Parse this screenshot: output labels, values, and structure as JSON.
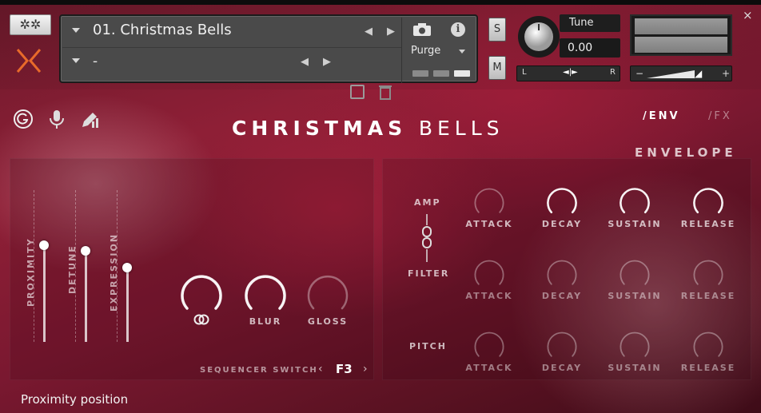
{
  "header": {
    "gear_label": "✲✲",
    "preset": {
      "name": "01. Christmas Bells",
      "sub": "-",
      "purge_label": "Purge"
    },
    "solo_label": "S",
    "mute_label": "M",
    "tune": {
      "label": "Tune",
      "value": "0.00"
    },
    "pan": {
      "left": "L",
      "right": "R"
    },
    "volume": {
      "minus": "−",
      "plus": "+"
    },
    "close_label": "×"
  },
  "instrument": {
    "title_bold": "CHRISTMAS",
    "title_light": "BELLS",
    "tabs": {
      "env": "/ENV",
      "fx": "/FX"
    },
    "envelope_heading": "ENVELOPE",
    "sliders": [
      {
        "label": "PROXIMITY",
        "value": 0.67
      },
      {
        "label": "DETUNE",
        "value": 0.63
      },
      {
        "label": "EXPRESSION",
        "value": 0.52
      }
    ],
    "knobs": [
      {
        "label": "",
        "icon": "double-ring-icon"
      },
      {
        "label": "BLUR"
      },
      {
        "label": "GLOSS"
      }
    ],
    "sequencer": {
      "label": "SEQUENCER SWITCH",
      "value": "F3",
      "prev": "‹",
      "next": "›"
    },
    "env_rows": [
      {
        "label": "AMP",
        "knobs": [
          "ATTACK",
          "DECAY",
          "SUSTAIN",
          "RELEASE"
        ]
      },
      {
        "label": "FILTER",
        "knobs": [
          "ATTACK",
          "DECAY",
          "SUSTAIN",
          "RELEASE"
        ]
      },
      {
        "label": "PITCH",
        "knobs": [
          "ATTACK",
          "DECAY",
          "SUSTAIN",
          "RELEASE"
        ]
      }
    ]
  },
  "status": {
    "text": "Proximity position"
  },
  "colors": {
    "accent_orange": "#e86a2a",
    "bg_crimson": "#8e1f36"
  }
}
